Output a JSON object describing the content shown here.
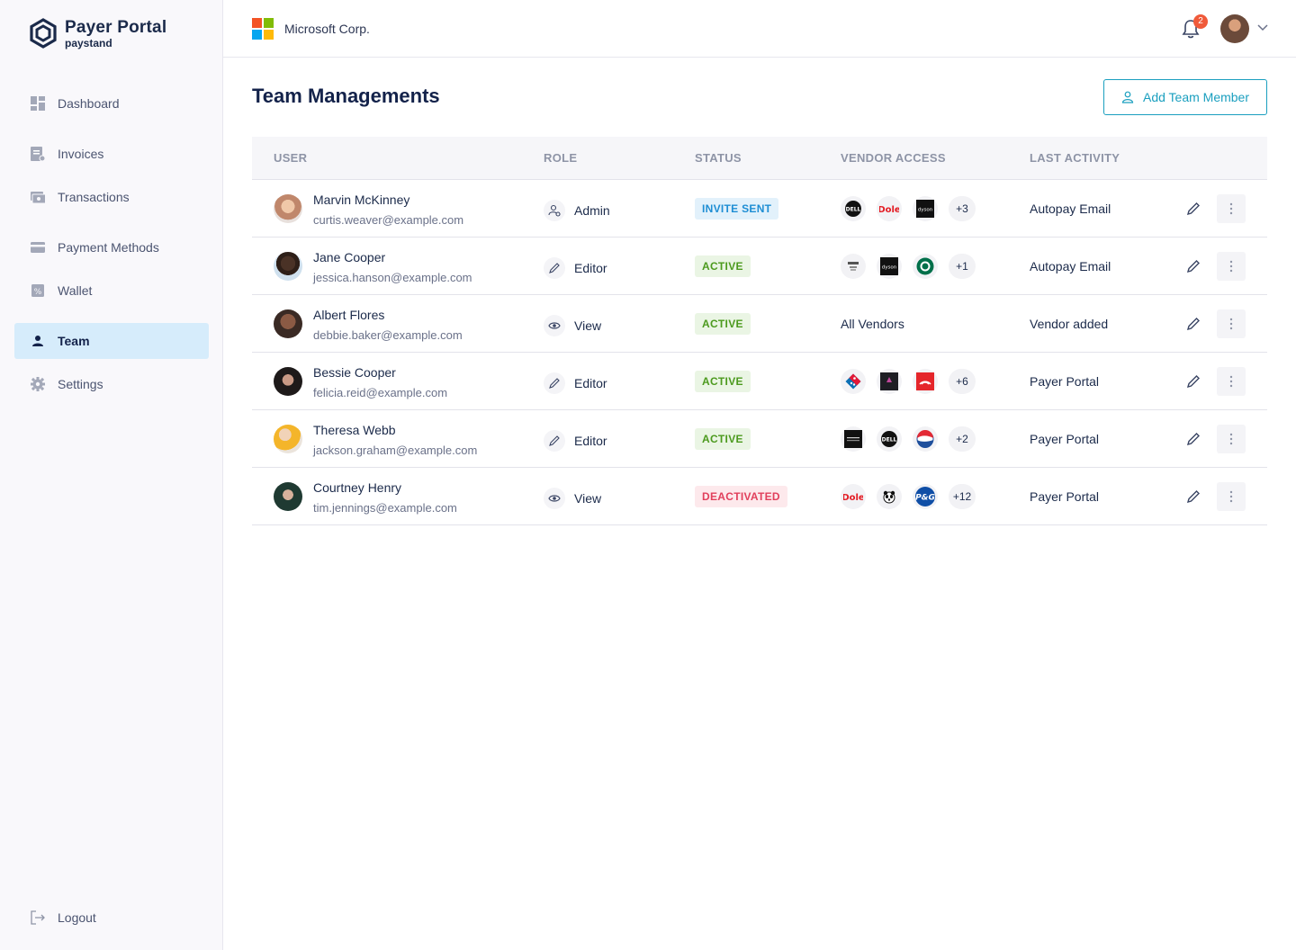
{
  "brand": {
    "title": "Payer Portal",
    "subtitle": "paystand"
  },
  "nav": {
    "items": [
      {
        "label": "Dashboard",
        "icon": "dashboard-icon"
      },
      {
        "label": "Invoices",
        "icon": "invoice-icon"
      },
      {
        "label": "Transactions",
        "icon": "transactions-icon"
      },
      {
        "label": "Payment Methods",
        "icon": "card-icon"
      },
      {
        "label": "Wallet",
        "icon": "wallet-icon"
      },
      {
        "label": "Team",
        "icon": "person-icon",
        "active": true
      },
      {
        "label": "Settings",
        "icon": "gear-icon"
      }
    ],
    "logout": "Logout"
  },
  "topbar": {
    "company": "Microsoft Corp.",
    "notifications": "2"
  },
  "page": {
    "title": "Team Managements",
    "add_button": "Add Team Member"
  },
  "table": {
    "headers": [
      "USER",
      "ROLE",
      "STATUS",
      "VENDOR ACCESS",
      "LAST ACTIVITY"
    ],
    "rows": [
      {
        "name": "Marvin McKinney",
        "email": "curtis.weaver@example.com",
        "role": "Admin",
        "status": "INVITE SENT",
        "vendors": [
          "Dell",
          "Dole",
          "dyson"
        ],
        "extra": "+3",
        "activity": "Autopay Email"
      },
      {
        "name": "Jane Cooper",
        "email": "jessica.hanson@example.com",
        "role": "Editor",
        "status": "ACTIVE",
        "vendors": [
          "vendor",
          "dyson",
          "Starbucks"
        ],
        "extra": "+1",
        "activity": "Autopay Email"
      },
      {
        "name": "Albert Flores",
        "email": "debbie.baker@example.com",
        "role": "View",
        "status": "ACTIVE",
        "vendor_text": "All Vendors",
        "activity": "Vendor added"
      },
      {
        "name": "Bessie Cooper",
        "email": "felicia.reid@example.com",
        "role": "Editor",
        "status": "ACTIVE",
        "vendors": [
          "Domino's",
          "vendor",
          "The North Face"
        ],
        "extra": "+6",
        "activity": "Payer Portal"
      },
      {
        "name": "Theresa Webb",
        "email": "jackson.graham@example.com",
        "role": "Editor",
        "status": "ACTIVE",
        "vendors": [
          "vendor",
          "Dell",
          "Pepsi"
        ],
        "extra": "+2",
        "activity": "Payer Portal"
      },
      {
        "name": "Courtney Henry",
        "email": "tim.jennings@example.com",
        "role": "View",
        "status": "DEACTIVATED",
        "vendors": [
          "Dole",
          "WWF",
          "P&G"
        ],
        "extra": "+12",
        "activity": "Payer Portal"
      }
    ]
  },
  "colors": {
    "accent": "#1a9fbf",
    "active_nav": "#d6ecfb",
    "invite": "#1e8ed4",
    "active": "#4c9a1e",
    "deactivated": "#e1405c"
  }
}
